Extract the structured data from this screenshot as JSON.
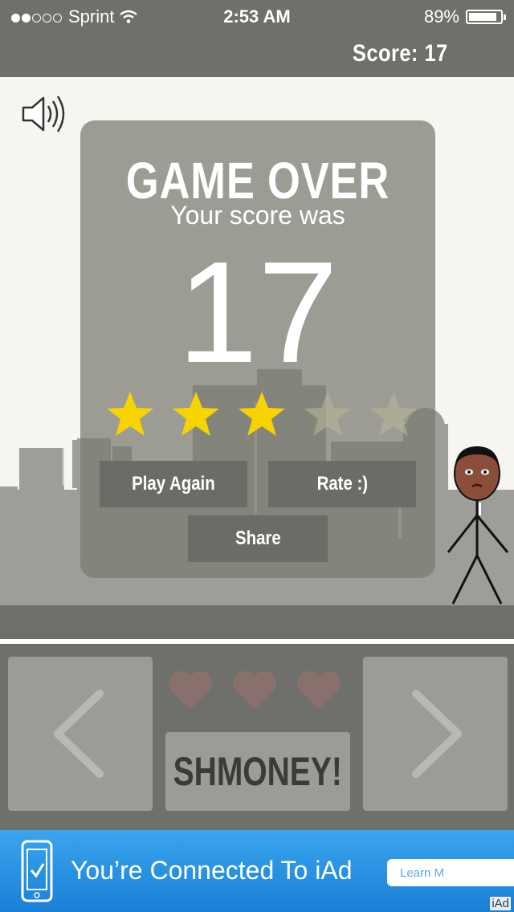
{
  "status_bar": {
    "carrier": "Sprint",
    "signal_dots_filled": 2,
    "signal_dots_total": 5,
    "time": "2:53 AM",
    "battery_percent": "89%",
    "battery_level": 0.89
  },
  "header": {
    "score_label": "Score: 17"
  },
  "game_over": {
    "title": "GAME OVER",
    "subtitle": "Your score was",
    "score": "17",
    "stars_filled": 3,
    "stars_total": 5,
    "buttons": {
      "play_again": "Play Again",
      "rate": "Rate :)",
      "share": "Share"
    }
  },
  "controls": {
    "lives_total": 3,
    "action_label": "SHMONEY!"
  },
  "ad": {
    "text": "You’re Connected To iAd",
    "learn_more": "Learn M",
    "logo": "iAd"
  },
  "colors": {
    "star_on": "#f7d300",
    "star_off": "#b7b597",
    "heart": "#8a706c",
    "bar": "#6d706b",
    "ad_blue": "#1a7fd6"
  }
}
